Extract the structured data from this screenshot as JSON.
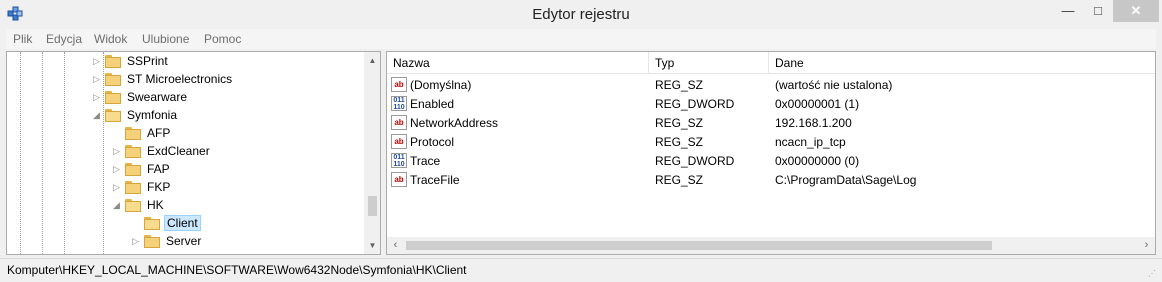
{
  "window": {
    "title": "Edytor rejestru",
    "minimize_glyph": "—",
    "maximize_glyph": "□",
    "close_glyph": "✕"
  },
  "menu": [
    "Plik",
    "Edycja",
    "Widok",
    "Ulubione",
    "Pomoc"
  ],
  "tree": {
    "items": [
      {
        "label": "SSPrint",
        "expanded": false,
        "selected": false
      },
      {
        "label": "ST Microelectronics",
        "expanded": false,
        "selected": false
      },
      {
        "label": "Swearware",
        "expanded": false,
        "selected": false
      },
      {
        "label": "Symfonia",
        "expanded": true,
        "selected": false
      },
      {
        "label": "AFP",
        "expanded": null,
        "selected": false
      },
      {
        "label": "ExdCleaner",
        "expanded": false,
        "selected": false
      },
      {
        "label": "FAP",
        "expanded": false,
        "selected": false
      },
      {
        "label": "FKP",
        "expanded": false,
        "selected": false
      },
      {
        "label": "HK",
        "expanded": true,
        "selected": false
      },
      {
        "label": "Client",
        "expanded": null,
        "selected": true
      },
      {
        "label": "Server",
        "expanded": false,
        "selected": false
      }
    ],
    "arrow_collapsed": "▷",
    "arrow_expanded": "◢"
  },
  "list": {
    "headers": {
      "name": "Nazwa",
      "type": "Typ",
      "data": "Dane"
    },
    "rows": [
      {
        "name": "(Domyślna)",
        "type": "REG_SZ",
        "data": "(wartość nie ustalona)",
        "icon": "string-value-icon",
        "glyph": "ab"
      },
      {
        "name": "Enabled",
        "type": "REG_DWORD",
        "data": "0x00000001 (1)",
        "icon": "binary-value-icon",
        "glyph": "011\n110"
      },
      {
        "name": "NetworkAddress",
        "type": "REG_SZ",
        "data": "192.168.1.200",
        "icon": "string-value-icon",
        "glyph": "ab"
      },
      {
        "name": "Protocol",
        "type": "REG_SZ",
        "data": "ncacn_ip_tcp",
        "icon": "string-value-icon",
        "glyph": "ab"
      },
      {
        "name": "Trace",
        "type": "REG_DWORD",
        "data": "0x00000000 (0)",
        "icon": "binary-value-icon",
        "glyph": "011\n110"
      },
      {
        "name": "TraceFile",
        "type": "REG_SZ",
        "data": "C:\\ProgramData\\Sage\\Log",
        "icon": "string-value-icon",
        "glyph": "ab"
      }
    ]
  },
  "status": {
    "path": "Komputer\\HKEY_LOCAL_MACHINE\\SOFTWARE\\Wow6432Node\\Symfonia\\HK\\Client"
  }
}
